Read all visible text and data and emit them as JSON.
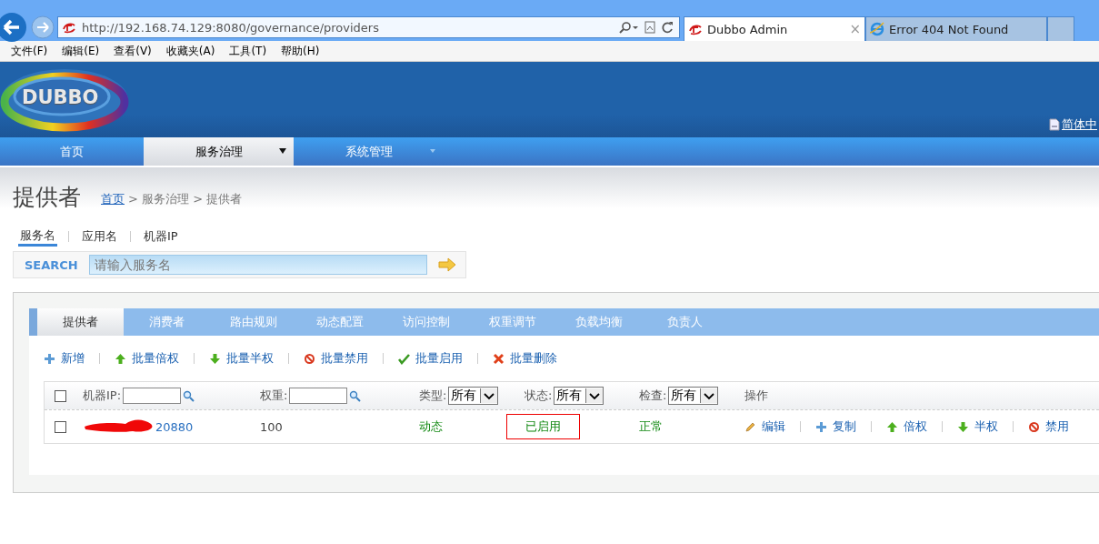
{
  "browser": {
    "address": "http://192.168.74.129:8080/governance/providers",
    "tabs": [
      {
        "title": "Dubbo Admin",
        "selected": true,
        "close": "×"
      },
      {
        "title": "Error 404 Not Found",
        "selected": false
      }
    ],
    "menu": [
      "文件(F)",
      "编辑(E)",
      "查看(V)",
      "收藏夹(A)",
      "工具(T)",
      "帮助(H)"
    ]
  },
  "header": {
    "logo": "DUBBO",
    "language": "简体中",
    "nav": [
      {
        "label": "首页",
        "selected": false,
        "dropdown": false
      },
      {
        "label": "服务治理",
        "selected": true,
        "dropdown": true
      },
      {
        "label": "系统管理",
        "selected": false,
        "dropdown": true
      }
    ]
  },
  "page": {
    "title": "提供者",
    "breadcrumb": {
      "link": "首页",
      "rest": "> 服务治理 > 提供者"
    },
    "search_tabs": [
      {
        "label": "服务名",
        "selected": true
      },
      {
        "label": "应用名",
        "selected": false
      },
      {
        "label": "机器IP",
        "selected": false
      }
    ],
    "search": {
      "label": "SEARCH",
      "placeholder": "请输入服务名"
    },
    "tabs": [
      {
        "label": "提供者",
        "selected": true
      },
      {
        "label": "消费者",
        "selected": false
      },
      {
        "label": "路由规则",
        "selected": false
      },
      {
        "label": "动态配置",
        "selected": false
      },
      {
        "label": "访问控制",
        "selected": false
      },
      {
        "label": "权重调节",
        "selected": false
      },
      {
        "label": "负载均衡",
        "selected": false
      },
      {
        "label": "负责人",
        "selected": false
      }
    ],
    "actions": [
      {
        "label": "新增",
        "kind": "plus"
      },
      {
        "label": "批量倍权",
        "kind": "up"
      },
      {
        "label": "批量半权",
        "kind": "down"
      },
      {
        "label": "批量禁用",
        "kind": "ban"
      },
      {
        "label": "批量启用",
        "kind": "check"
      },
      {
        "label": "批量删除",
        "kind": "cross"
      }
    ],
    "table": {
      "checked": false,
      "filters": [
        {
          "kind": "text",
          "label": "机器IP:"
        },
        {
          "kind": "text",
          "label": "权重:"
        },
        {
          "kind": "select",
          "label": "类型:",
          "value": "所有"
        },
        {
          "kind": "select",
          "label": "状态:",
          "value": "所有"
        },
        {
          "kind": "select",
          "label": "检查:",
          "value": "所有"
        },
        {
          "kind": "plain",
          "label": "操作"
        }
      ],
      "rows": [
        {
          "checked": false,
          "ip": "20880",
          "redacted": true,
          "weight": "100",
          "type": "动态",
          "status": "已启用",
          "highlighted": true,
          "check": "正常",
          "ops": [
            {
              "label": "编辑",
              "kind": "pencil"
            },
            {
              "label": "复制",
              "kind": "plus"
            },
            {
              "label": "倍权",
              "kind": "up"
            },
            {
              "label": "半权",
              "kind": "down"
            },
            {
              "label": "禁用",
              "kind": "ban"
            }
          ]
        }
      ]
    }
  }
}
